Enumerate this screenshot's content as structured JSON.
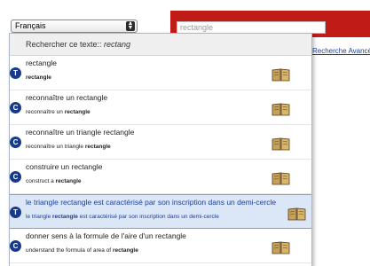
{
  "language_select": {
    "value": "Français"
  },
  "background": {
    "search_value": "rectangle",
    "advanced_link": "Recherche Avancé"
  },
  "dropdown": {
    "header_prefix": "Rechercher ce texte:: ",
    "header_query": "rectang",
    "items": [
      {
        "badge": "T",
        "title": "rectangle",
        "sub_pre": "",
        "sub_bold": "rectangle",
        "sub_post": "",
        "selected": false
      },
      {
        "badge": "C",
        "title": "reconnaître un rectangle",
        "sub_pre": "reconnaître un ",
        "sub_bold": "rectangle",
        "sub_post": "",
        "selected": false
      },
      {
        "badge": "C",
        "title": "reconnaître un triangle rectangle",
        "sub_pre": "reconnaître un triangle ",
        "sub_bold": "rectangle",
        "sub_post": "",
        "selected": false
      },
      {
        "badge": "C",
        "title": "construire un rectangle",
        "sub_pre": "construct a ",
        "sub_bold": "rectangle",
        "sub_post": "",
        "selected": false
      },
      {
        "badge": "T",
        "title": "le triangle rectangle est caractérisé par son inscription dans un demi-cercle",
        "sub_pre": "le triangle ",
        "sub_bold": "rectangle",
        "sub_post": " est caractérisé par son inscription dans un demi-cercle",
        "selected": true
      },
      {
        "badge": "C",
        "title": "donner sens à la formule de l'aire d'un rectangle",
        "sub_pre": "understand the formula of area of ",
        "sub_bold": "rectangle",
        "sub_post": "",
        "selected": false
      }
    ]
  },
  "colors": {
    "brand_red": "#c11b17",
    "badge_blue": "#173a8a",
    "selected_bg": "#dbe6f7"
  },
  "icons": {
    "item_action": "book-icon",
    "select_arrows": "updown-arrows-icon"
  }
}
